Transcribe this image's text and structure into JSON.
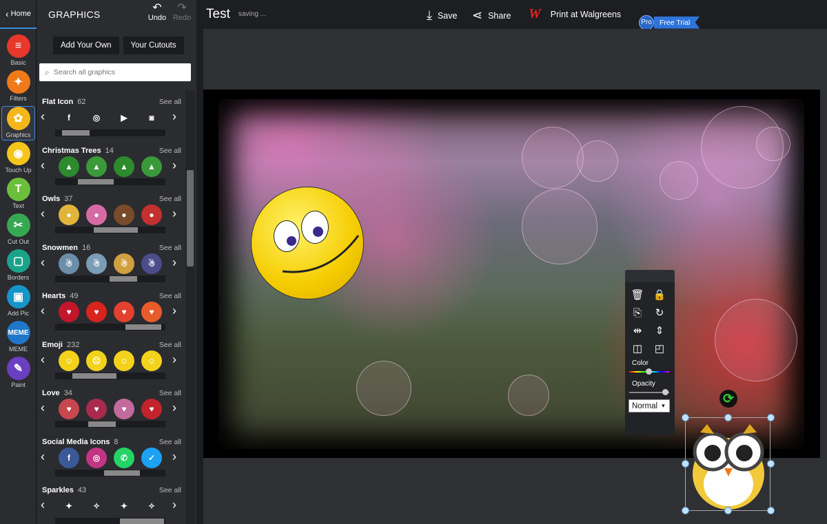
{
  "rail": {
    "home_label": "Home",
    "tools": [
      {
        "label": "Basic",
        "color": "#e8372b",
        "glyph": "≡"
      },
      {
        "label": "Filters",
        "color": "#f07a1a",
        "glyph": "✦"
      },
      {
        "label": "Graphics",
        "color": "#f3b71c",
        "glyph": "✿"
      },
      {
        "label": "Touch Up",
        "color": "#f4c51b",
        "glyph": "◉"
      },
      {
        "label": "Text",
        "color": "#6cbf3c",
        "glyph": "T"
      },
      {
        "label": "Cut Out",
        "color": "#37a852",
        "glyph": "✂"
      },
      {
        "label": "Borders",
        "color": "#1aa38b",
        "glyph": "▢"
      },
      {
        "label": "Add Pic",
        "color": "#1696c8",
        "glyph": "▣"
      },
      {
        "label": "MEME",
        "color": "#2077c9",
        "glyph": "MEME"
      },
      {
        "label": "Paint",
        "color": "#6a3fc2",
        "glyph": "✎"
      }
    ]
  },
  "panel": {
    "title": "GRAPHICS",
    "undo_label": "Undo",
    "redo_label": "Redo",
    "add_own_label": "Add Your Own",
    "cutouts_label": "Your Cutouts",
    "search_placeholder": "Search all graphics",
    "see_all": "See all",
    "categories": [
      {
        "name": "Flat Icon",
        "count": "62",
        "thumbs": [
          "f",
          "◎",
          "▶",
          "◙"
        ],
        "colors": [
          "#2b2c30",
          "#2b2c30",
          "#2b2c30",
          "#2b2c30"
        ]
      },
      {
        "name": "Christmas Trees",
        "count": "14",
        "thumbs": [
          "▲",
          "▲",
          "▲",
          "▲"
        ],
        "colors": [
          "#2d8a2d",
          "#3a9a3a",
          "#2d8a2d",
          "#3a9a3a"
        ]
      },
      {
        "name": "Owls",
        "count": "37",
        "thumbs": [
          "●",
          "●",
          "●",
          "●"
        ],
        "colors": [
          "#e0b53a",
          "#d76aa5",
          "#7a4b2a",
          "#c23030"
        ]
      },
      {
        "name": "Snowmen",
        "count": "16",
        "thumbs": [
          "☃",
          "☃",
          "☃",
          "☃"
        ],
        "colors": [
          "#6c8ea8",
          "#7a9cb4",
          "#d0a040",
          "#4c4c8a"
        ]
      },
      {
        "name": "Hearts",
        "count": "49",
        "thumbs": [
          "♥",
          "♥",
          "♥",
          "♥"
        ],
        "colors": [
          "#c4162b",
          "#d8231e",
          "#e4402f",
          "#e75c2a"
        ]
      },
      {
        "name": "Emoji",
        "count": "232",
        "thumbs": [
          "☺",
          "☹",
          "☺",
          "☺"
        ],
        "colors": [
          "#f3d21c",
          "#f3d21c",
          "#f3d21c",
          "#f3d21c"
        ]
      },
      {
        "name": "Love",
        "count": "34",
        "thumbs": [
          "♥",
          "♥",
          "♥",
          "♥"
        ],
        "colors": [
          "#c8474e",
          "#a82b4d",
          "#c26a9b",
          "#c2232d"
        ]
      },
      {
        "name": "Social Media Icons",
        "count": "8",
        "thumbs": [
          "f",
          "◎",
          "✆",
          "✓"
        ],
        "colors": [
          "#3b5998",
          "#c13584",
          "#25d366",
          "#1da1f2"
        ]
      },
      {
        "name": "Sparkles",
        "count": "43",
        "thumbs": [
          "✦",
          "✧",
          "✦",
          "✧"
        ],
        "colors": [
          "#2b2c30",
          "#2b2c30",
          "#2b2c30",
          "#2b2c30"
        ]
      }
    ]
  },
  "topbar": {
    "doc_title": "Test",
    "status": "saving ...",
    "save_label": "Save",
    "share_label": "Share",
    "walgreens_logo": "W",
    "print_label": "Print at Walgreens",
    "pro_badge": "Pro",
    "trial_label": "Free Trial"
  },
  "ftoolbar": {
    "color_label": "Color",
    "opacity_label": "Opacity",
    "blend_value": "Normal"
  }
}
